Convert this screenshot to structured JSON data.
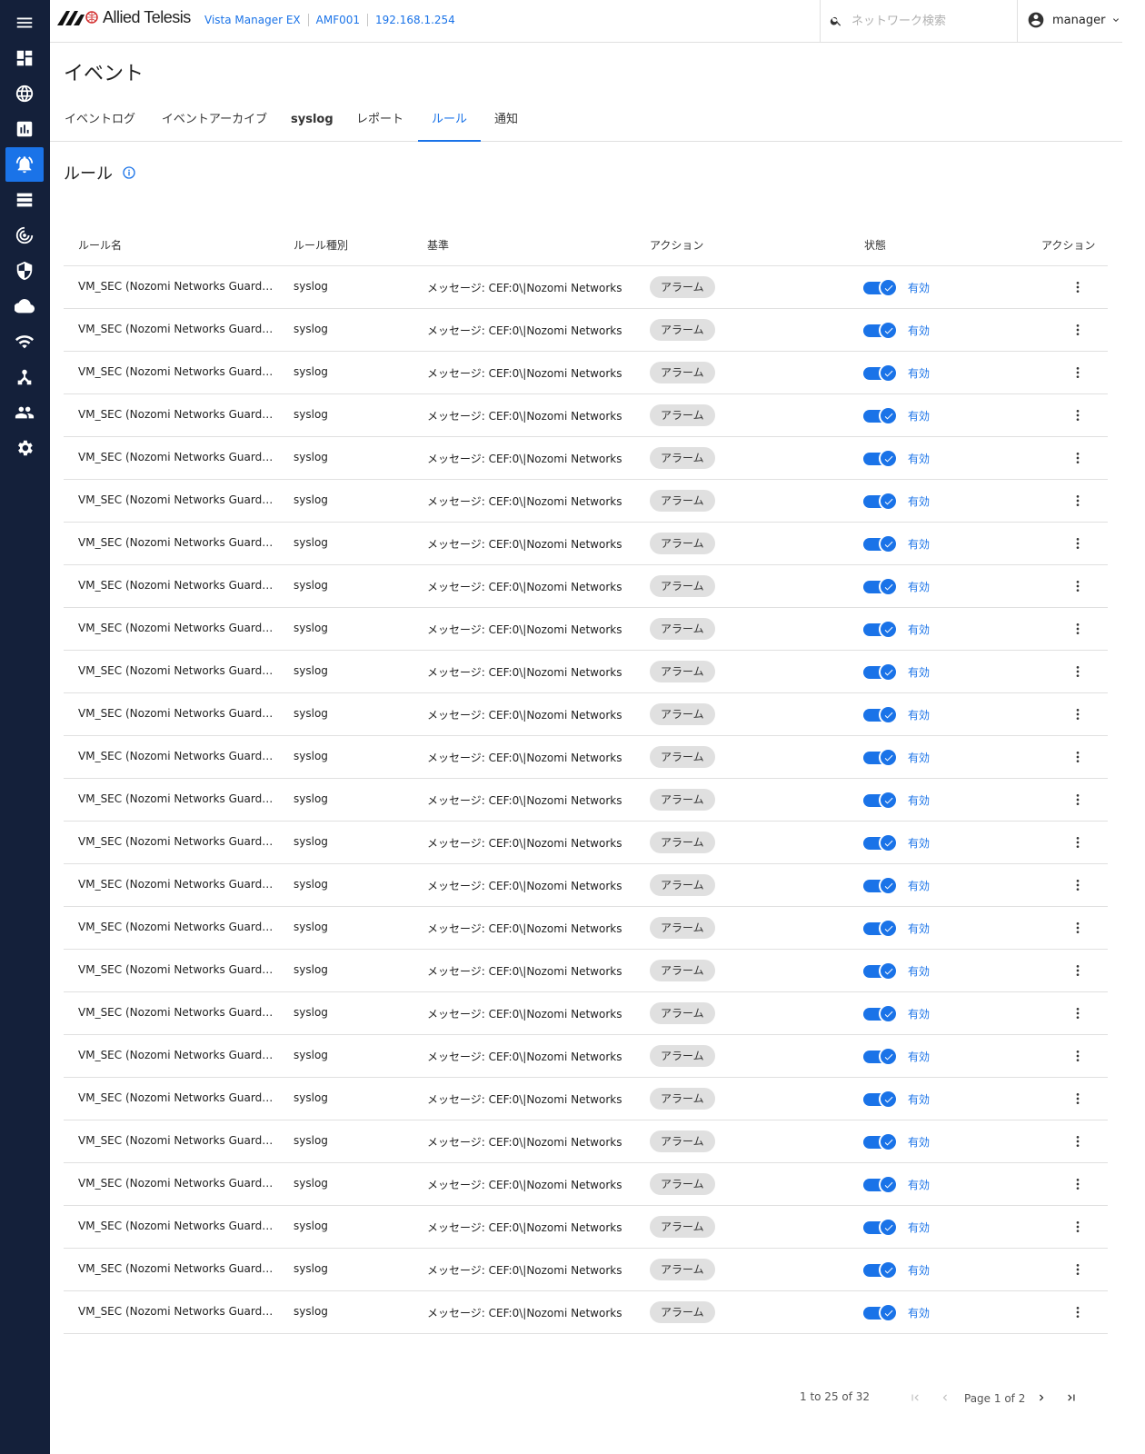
{
  "app": {
    "brand": "Allied Telesis",
    "breadcrumb": [
      "Vista Manager EX",
      "AMF001",
      "192.168.1.254"
    ]
  },
  "search": {
    "placeholder": "ネットワーク検索",
    "value": ""
  },
  "user": {
    "name": "manager"
  },
  "sidebar": {
    "items": [
      {
        "name": "menu",
        "icon": "hamburger-icon"
      },
      {
        "name": "dashboard",
        "icon": "dashboard-icon"
      },
      {
        "name": "network",
        "icon": "globe-icon"
      },
      {
        "name": "reports",
        "icon": "chart-icon"
      },
      {
        "name": "events",
        "icon": "bell-icon",
        "active": true
      },
      {
        "name": "list",
        "icon": "list-icon"
      },
      {
        "name": "monitor",
        "icon": "radar-icon"
      },
      {
        "name": "security",
        "icon": "shield-icon"
      },
      {
        "name": "cloud",
        "icon": "cloud-icon"
      },
      {
        "name": "wireless",
        "icon": "wifi-icon"
      },
      {
        "name": "topology",
        "icon": "hub-icon"
      },
      {
        "name": "users",
        "icon": "people-icon"
      },
      {
        "name": "settings",
        "icon": "gear-icon"
      }
    ]
  },
  "page": {
    "title": "イベント",
    "tabs": [
      {
        "label": "イベントログ"
      },
      {
        "label": "イベントアーカイブ"
      },
      {
        "label": "syslog"
      },
      {
        "label": "レポート"
      },
      {
        "label": "ルール",
        "active": true
      },
      {
        "label": "通知"
      }
    ],
    "section_title": "ルール"
  },
  "table": {
    "headers": {
      "name": "ルール名",
      "type": "ルール種別",
      "criteria": "基準",
      "action": "アクション",
      "status": "状態",
      "actions": "アクション"
    },
    "rows": [
      {
        "name": "VM_SEC (Nozomi Networks Guardian)",
        "type": "syslog",
        "criteria": "メッセージ: CEF:0\\|Nozomi Networks",
        "action": "アラーム",
        "status": "有効"
      },
      {
        "name": "VM_SEC (Nozomi Networks Guardian)",
        "type": "syslog",
        "criteria": "メッセージ: CEF:0\\|Nozomi Networks",
        "action": "アラーム",
        "status": "有効"
      },
      {
        "name": "VM_SEC (Nozomi Networks Guardian)",
        "type": "syslog",
        "criteria": "メッセージ: CEF:0\\|Nozomi Networks",
        "action": "アラーム",
        "status": "有効"
      },
      {
        "name": "VM_SEC (Nozomi Networks Guardian)",
        "type": "syslog",
        "criteria": "メッセージ: CEF:0\\|Nozomi Networks",
        "action": "アラーム",
        "status": "有効"
      },
      {
        "name": "VM_SEC (Nozomi Networks Guardian)",
        "type": "syslog",
        "criteria": "メッセージ: CEF:0\\|Nozomi Networks",
        "action": "アラーム",
        "status": "有効"
      },
      {
        "name": "VM_SEC (Nozomi Networks Guardian)",
        "type": "syslog",
        "criteria": "メッセージ: CEF:0\\|Nozomi Networks",
        "action": "アラーム",
        "status": "有効"
      },
      {
        "name": "VM_SEC (Nozomi Networks Guardian)",
        "type": "syslog",
        "criteria": "メッセージ: CEF:0\\|Nozomi Networks",
        "action": "アラーム",
        "status": "有効"
      },
      {
        "name": "VM_SEC (Nozomi Networks Guardian)",
        "type": "syslog",
        "criteria": "メッセージ: CEF:0\\|Nozomi Networks",
        "action": "アラーム",
        "status": "有効"
      },
      {
        "name": "VM_SEC (Nozomi Networks Guardian)",
        "type": "syslog",
        "criteria": "メッセージ: CEF:0\\|Nozomi Networks",
        "action": "アラーム",
        "status": "有効"
      },
      {
        "name": "VM_SEC (Nozomi Networks Guardian)",
        "type": "syslog",
        "criteria": "メッセージ: CEF:0\\|Nozomi Networks",
        "action": "アラーム",
        "status": "有効"
      },
      {
        "name": "VM_SEC (Nozomi Networks Guardian)",
        "type": "syslog",
        "criteria": "メッセージ: CEF:0\\|Nozomi Networks",
        "action": "アラーム",
        "status": "有効"
      },
      {
        "name": "VM_SEC (Nozomi Networks Guardian)",
        "type": "syslog",
        "criteria": "メッセージ: CEF:0\\|Nozomi Networks",
        "action": "アラーム",
        "status": "有効"
      },
      {
        "name": "VM_SEC (Nozomi Networks Guardian)",
        "type": "syslog",
        "criteria": "メッセージ: CEF:0\\|Nozomi Networks",
        "action": "アラーム",
        "status": "有効"
      },
      {
        "name": "VM_SEC (Nozomi Networks Guardian)",
        "type": "syslog",
        "criteria": "メッセージ: CEF:0\\|Nozomi Networks",
        "action": "アラーム",
        "status": "有効"
      },
      {
        "name": "VM_SEC (Nozomi Networks Guardian)",
        "type": "syslog",
        "criteria": "メッセージ: CEF:0\\|Nozomi Networks",
        "action": "アラーム",
        "status": "有効"
      },
      {
        "name": "VM_SEC (Nozomi Networks Guardian)",
        "type": "syslog",
        "criteria": "メッセージ: CEF:0\\|Nozomi Networks",
        "action": "アラーム",
        "status": "有効"
      },
      {
        "name": "VM_SEC (Nozomi Networks Guardian)",
        "type": "syslog",
        "criteria": "メッセージ: CEF:0\\|Nozomi Networks",
        "action": "アラーム",
        "status": "有効"
      },
      {
        "name": "VM_SEC (Nozomi Networks Guardian)",
        "type": "syslog",
        "criteria": "メッセージ: CEF:0\\|Nozomi Networks",
        "action": "アラーム",
        "status": "有効"
      },
      {
        "name": "VM_SEC (Nozomi Networks Guardian)",
        "type": "syslog",
        "criteria": "メッセージ: CEF:0\\|Nozomi Networks",
        "action": "アラーム",
        "status": "有効"
      },
      {
        "name": "VM_SEC (Nozomi Networks Guardian)",
        "type": "syslog",
        "criteria": "メッセージ: CEF:0\\|Nozomi Networks",
        "action": "アラーム",
        "status": "有効"
      },
      {
        "name": "VM_SEC (Nozomi Networks Guardian)",
        "type": "syslog",
        "criteria": "メッセージ: CEF:0\\|Nozomi Networks",
        "action": "アラーム",
        "status": "有効"
      },
      {
        "name": "VM_SEC (Nozomi Networks Guardian)",
        "type": "syslog",
        "criteria": "メッセージ: CEF:0\\|Nozomi Networks",
        "action": "アラーム",
        "status": "有効"
      },
      {
        "name": "VM_SEC (Nozomi Networks Guardian)",
        "type": "syslog",
        "criteria": "メッセージ: CEF:0\\|Nozomi Networks",
        "action": "アラーム",
        "status": "有効"
      },
      {
        "name": "VM_SEC (Nozomi Networks Guardian)",
        "type": "syslog",
        "criteria": "メッセージ: CEF:0\\|Nozomi Networks",
        "action": "アラーム",
        "status": "有効"
      },
      {
        "name": "VM_SEC (Nozomi Networks Guardian)",
        "type": "syslog",
        "criteria": "メッセージ: CEF:0\\|Nozomi Networks",
        "action": "アラーム",
        "status": "有効"
      }
    ]
  },
  "pagination": {
    "summary": "1 to 25 of 32",
    "page_label": "Page 1 of 2"
  },
  "colors": {
    "sidebar_bg": "#14203a",
    "accent": "#1a73e8",
    "chip_bg": "#e0e0e0"
  }
}
